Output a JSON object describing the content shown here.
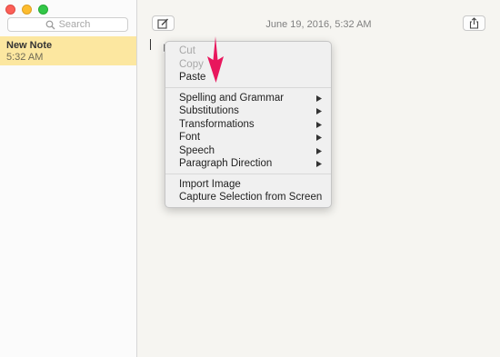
{
  "sidebar": {
    "search": {
      "placeholder": "Search"
    },
    "notes": [
      {
        "title": "New Note",
        "time": "5:32 AM"
      }
    ]
  },
  "main": {
    "date": "June 19, 2016, 5:32 AM"
  },
  "context_menu": {
    "group1": [
      {
        "label": "Cut",
        "enabled": false
      },
      {
        "label": "Copy",
        "enabled": false
      },
      {
        "label": "Paste",
        "enabled": true
      }
    ],
    "group2": [
      {
        "label": "Spelling and Grammar",
        "submenu": true
      },
      {
        "label": "Substitutions",
        "submenu": true
      },
      {
        "label": "Transformations",
        "submenu": true
      },
      {
        "label": "Font",
        "submenu": true
      },
      {
        "label": "Speech",
        "submenu": true
      },
      {
        "label": "Paragraph Direction",
        "submenu": true
      }
    ],
    "group3": [
      {
        "label": "Import Image"
      },
      {
        "label": "Capture Selection from Screen"
      }
    ]
  },
  "colors": {
    "selected_note": "#fce7a0",
    "annotation_arrow": "#e8175d",
    "close": "#fc5f57",
    "minimize": "#fdbc2e",
    "zoom": "#33c748"
  },
  "icons": {
    "compose": "compose-icon",
    "share": "share-icon",
    "search": "search-icon",
    "submenu": "submenu-arrow-icon"
  }
}
